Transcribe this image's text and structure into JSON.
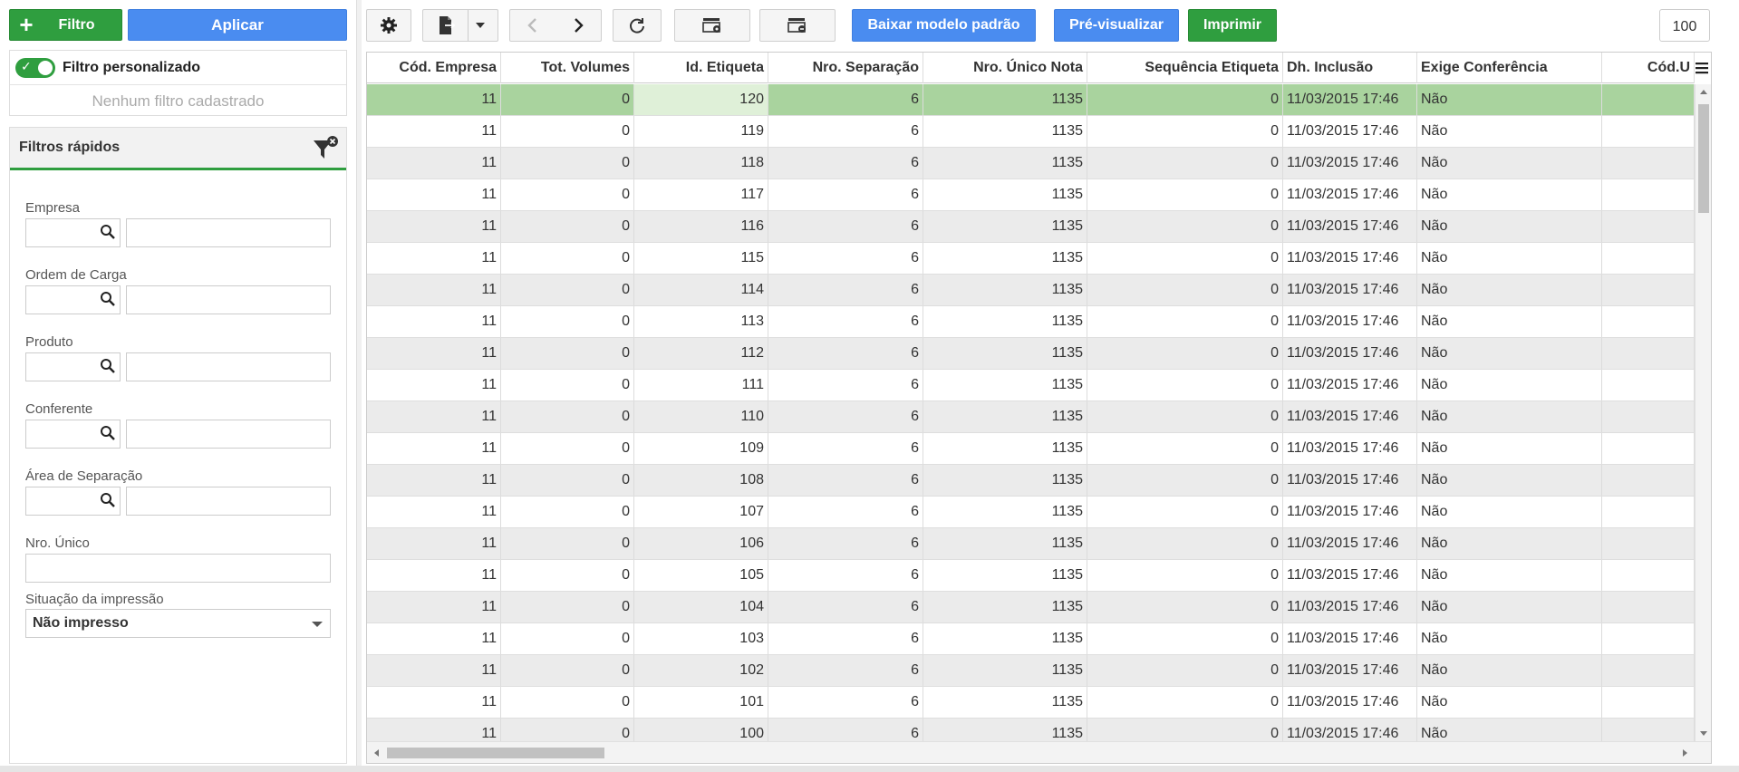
{
  "left_panel": {
    "filter_button_label": "Filtro",
    "apply_button_label": "Aplicar",
    "custom_filter_label": "Filtro personalizado",
    "no_filter_text": "Nenhum filtro cadastrado",
    "quick_filters_title": "Filtros rápidos",
    "fields": {
      "empresa": "Empresa",
      "ordem_carga": "Ordem de Carga",
      "produto": "Produto",
      "conferente": "Conferente",
      "area_separacao": "Área de Separação",
      "nro_unico": "Nro. Único",
      "situacao_impressao": "Situação da impressão"
    },
    "situacao_value": "Não impresso"
  },
  "toolbar": {
    "download_model_label": "Baixar modelo padrão",
    "preview_label": "Pré-visualizar",
    "print_label": "Imprimir",
    "page_size": "100"
  },
  "grid": {
    "columns": [
      "Cód. Empresa",
      "Tot. Volumes",
      "Id. Etiqueta",
      "Nro. Separação",
      "Nro. Único Nota",
      "Sequência Etiqueta",
      "Dh. Inclusão",
      "Exige Conferência",
      "Cód.U"
    ],
    "rows": [
      [
        "11",
        "0",
        "120",
        "6",
        "1135",
        "0",
        "11/03/2015 17:46",
        "Não",
        ""
      ],
      [
        "11",
        "0",
        "119",
        "6",
        "1135",
        "0",
        "11/03/2015 17:46",
        "Não",
        ""
      ],
      [
        "11",
        "0",
        "118",
        "6",
        "1135",
        "0",
        "11/03/2015 17:46",
        "Não",
        ""
      ],
      [
        "11",
        "0",
        "117",
        "6",
        "1135",
        "0",
        "11/03/2015 17:46",
        "Não",
        ""
      ],
      [
        "11",
        "0",
        "116",
        "6",
        "1135",
        "0",
        "11/03/2015 17:46",
        "Não",
        ""
      ],
      [
        "11",
        "0",
        "115",
        "6",
        "1135",
        "0",
        "11/03/2015 17:46",
        "Não",
        ""
      ],
      [
        "11",
        "0",
        "114",
        "6",
        "1135",
        "0",
        "11/03/2015 17:46",
        "Não",
        ""
      ],
      [
        "11",
        "0",
        "113",
        "6",
        "1135",
        "0",
        "11/03/2015 17:46",
        "Não",
        ""
      ],
      [
        "11",
        "0",
        "112",
        "6",
        "1135",
        "0",
        "11/03/2015 17:46",
        "Não",
        ""
      ],
      [
        "11",
        "0",
        "111",
        "6",
        "1135",
        "0",
        "11/03/2015 17:46",
        "Não",
        ""
      ],
      [
        "11",
        "0",
        "110",
        "6",
        "1135",
        "0",
        "11/03/2015 17:46",
        "Não",
        ""
      ],
      [
        "11",
        "0",
        "109",
        "6",
        "1135",
        "0",
        "11/03/2015 17:46",
        "Não",
        ""
      ],
      [
        "11",
        "0",
        "108",
        "6",
        "1135",
        "0",
        "11/03/2015 17:46",
        "Não",
        ""
      ],
      [
        "11",
        "0",
        "107",
        "6",
        "1135",
        "0",
        "11/03/2015 17:46",
        "Não",
        ""
      ],
      [
        "11",
        "0",
        "106",
        "6",
        "1135",
        "0",
        "11/03/2015 17:46",
        "Não",
        ""
      ],
      [
        "11",
        "0",
        "105",
        "6",
        "1135",
        "0",
        "11/03/2015 17:46",
        "Não",
        ""
      ],
      [
        "11",
        "0",
        "104",
        "6",
        "1135",
        "0",
        "11/03/2015 17:46",
        "Não",
        ""
      ],
      [
        "11",
        "0",
        "103",
        "6",
        "1135",
        "0",
        "11/03/2015 17:46",
        "Não",
        ""
      ],
      [
        "11",
        "0",
        "102",
        "6",
        "1135",
        "0",
        "11/03/2015 17:46",
        "Não",
        ""
      ],
      [
        "11",
        "0",
        "101",
        "6",
        "1135",
        "0",
        "11/03/2015 17:46",
        "Não",
        ""
      ],
      [
        "11",
        "0",
        "100",
        "6",
        "1135",
        "0",
        "11/03/2015 17:46",
        "Não",
        ""
      ]
    ]
  },
  "colors": {
    "accent_green": "#2f9e3f",
    "accent_blue": "#4a8cf0",
    "selected_row": "#a9d39e",
    "stripe_row": "#ebebeb"
  }
}
